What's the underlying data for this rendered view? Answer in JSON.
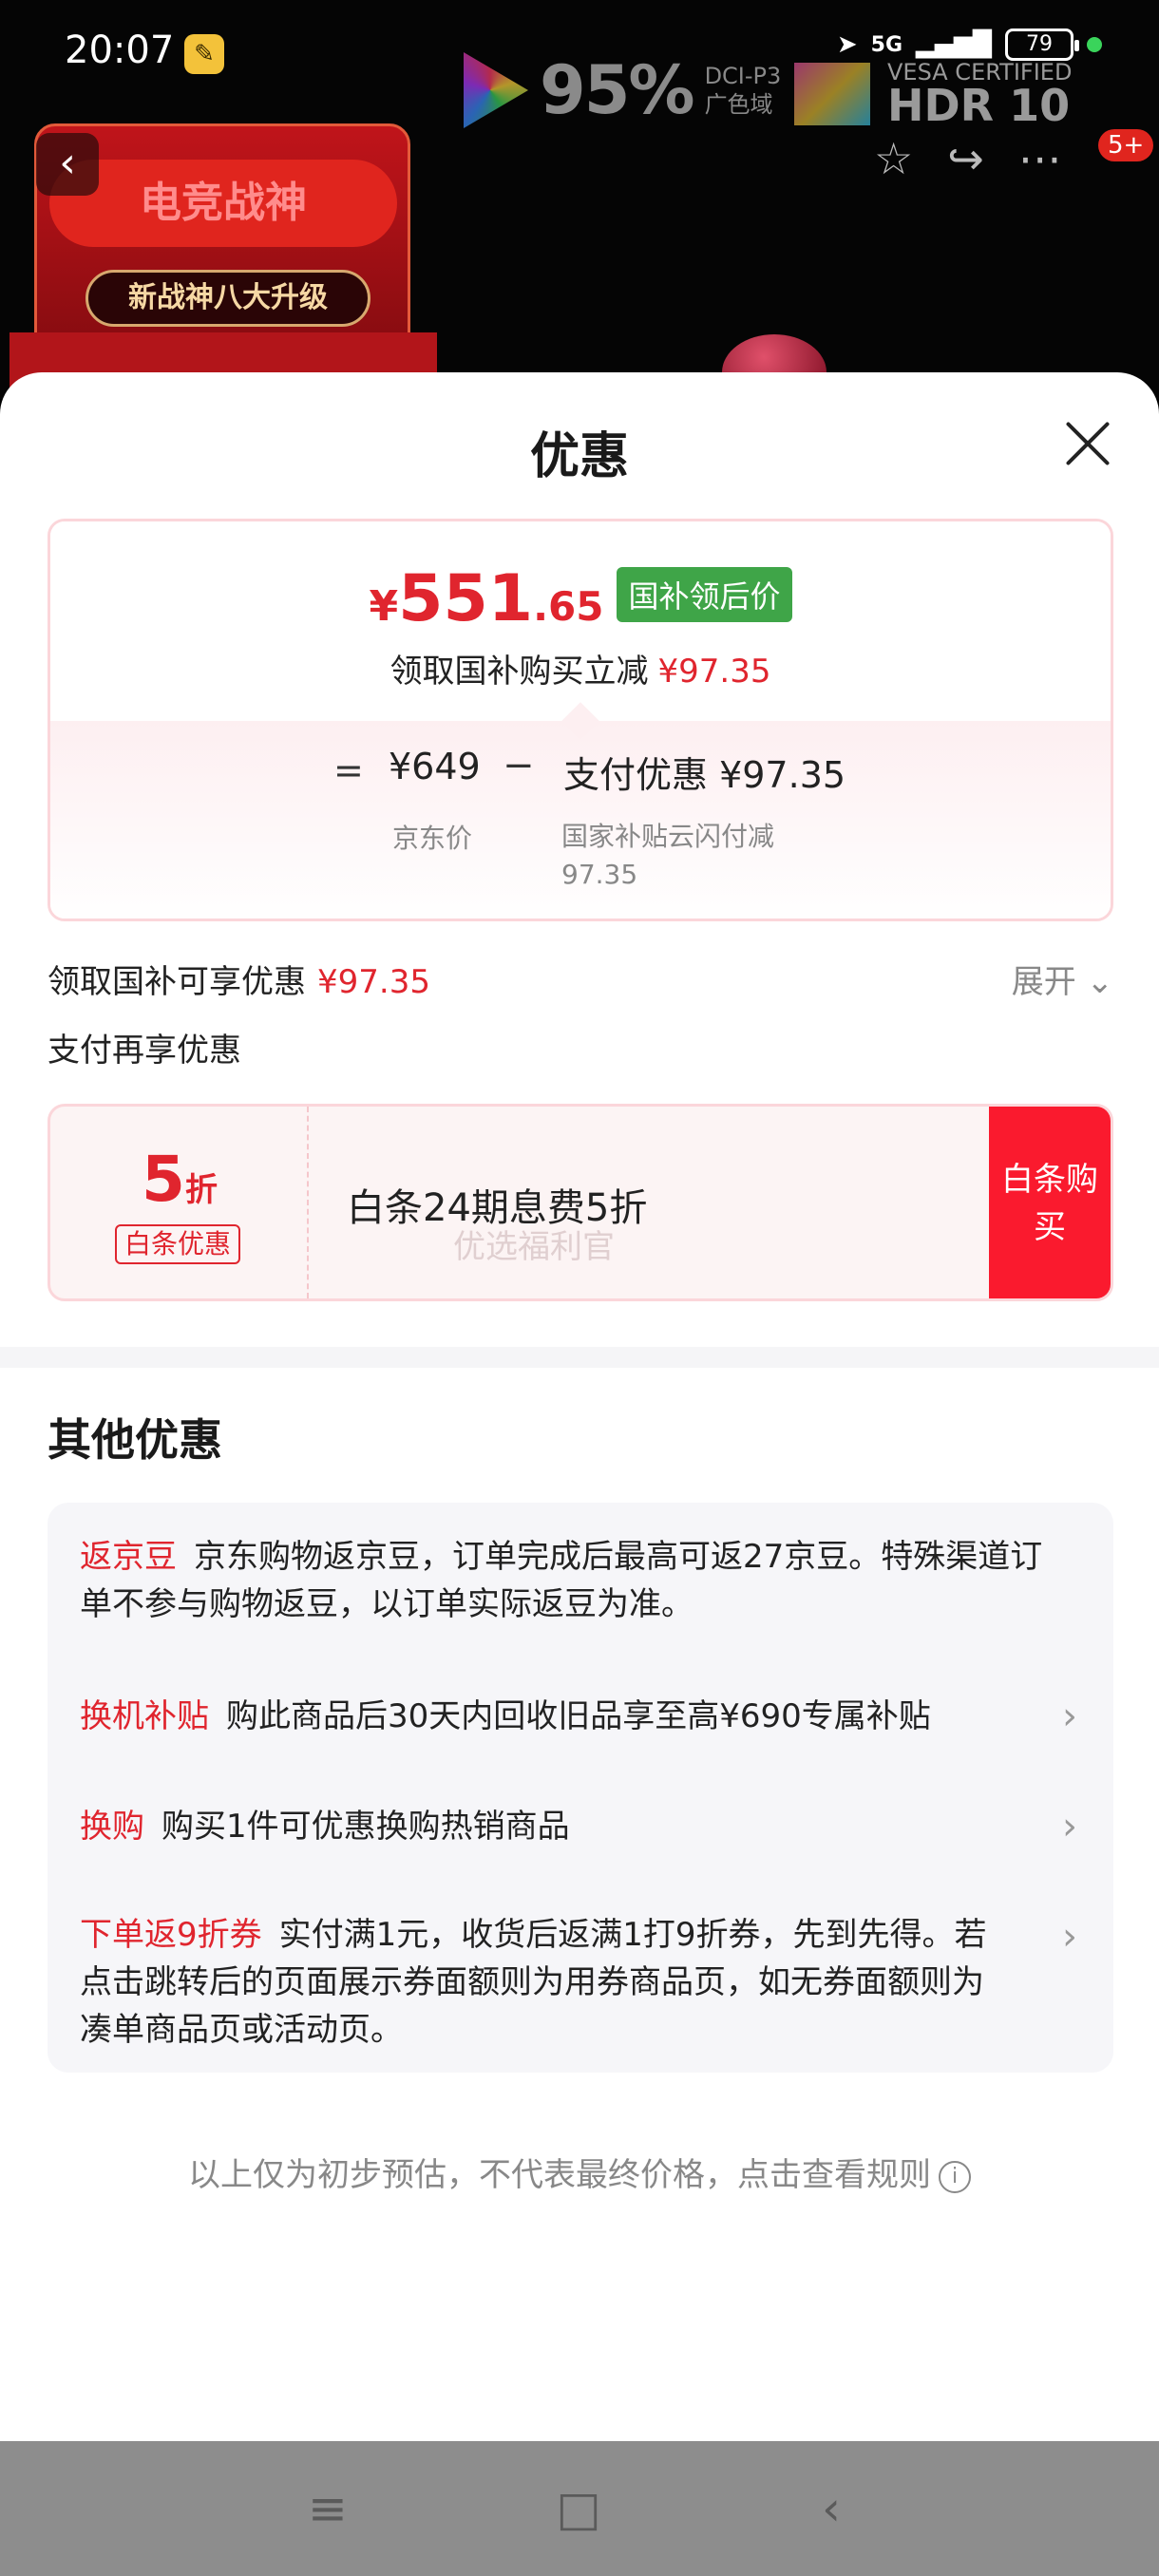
{
  "status_bar": {
    "time": "20:07",
    "network": "5G",
    "battery": "79"
  },
  "background": {
    "banner_title": "电竞战神",
    "banner_subtitle": "新战神八大升级",
    "color_gamut_pct": "95%",
    "color_gamut_label1": "DCI-P3",
    "color_gamut_label2": "广色域",
    "hdr_certified": "VESA CERTIFIED",
    "hdr_label": "HDR 10",
    "message_badge": "5+"
  },
  "sheet": {
    "title": "优惠",
    "price_card": {
      "currency": "¥",
      "price_int": "551",
      "price_dec": ".65",
      "tag": "国补领后价",
      "subtitle": "领取国补购买立减",
      "subtitle_amount": "¥97.35",
      "equals": "=",
      "jd_price": "¥649",
      "minus": "−",
      "pay_discount": "支付优惠 ¥97.35",
      "jd_price_label": "京东价",
      "pay_discount_label": "国家补贴云闪付减97.35"
    },
    "subsidy_row": {
      "label": "领取国补可享优惠",
      "amount": "¥97.35",
      "expand": "展开"
    },
    "pay_more_label": "支付再享优惠",
    "baitiao": {
      "discount_num": "5",
      "discount_unit": "折",
      "tag": "白条优惠",
      "desc": "白条24期息费5折",
      "watermark": "优选福利官",
      "button": "白条购买"
    },
    "other": {
      "title": "其他优惠",
      "items": [
        {
          "tag": "返京豆",
          "text": "京东购物返京豆，订单完成后最高可返27京豆。特殊渠道订单不参与购物返豆，以订单实际返豆为准。"
        },
        {
          "tag": "换机补贴",
          "text": "购此商品后30天内回收旧品享至高¥690专属补贴"
        },
        {
          "tag": "换购",
          "text": "购买1件可优惠换购热销商品"
        },
        {
          "tag": "下单返9折券",
          "text": "实付满1元，收货后返满1打9折券，先到先得。若点击跳转后的页面展示券面额则为用券商品页，如无券面额则为凑单商品页或活动页。"
        }
      ]
    },
    "footnote": "以上仅为初步预估，不代表最终价格，点击查看规则"
  },
  "colors": {
    "accent_red": "#e0252e",
    "tag_green": "#3fa548",
    "button_red": "#fa1a2e"
  }
}
